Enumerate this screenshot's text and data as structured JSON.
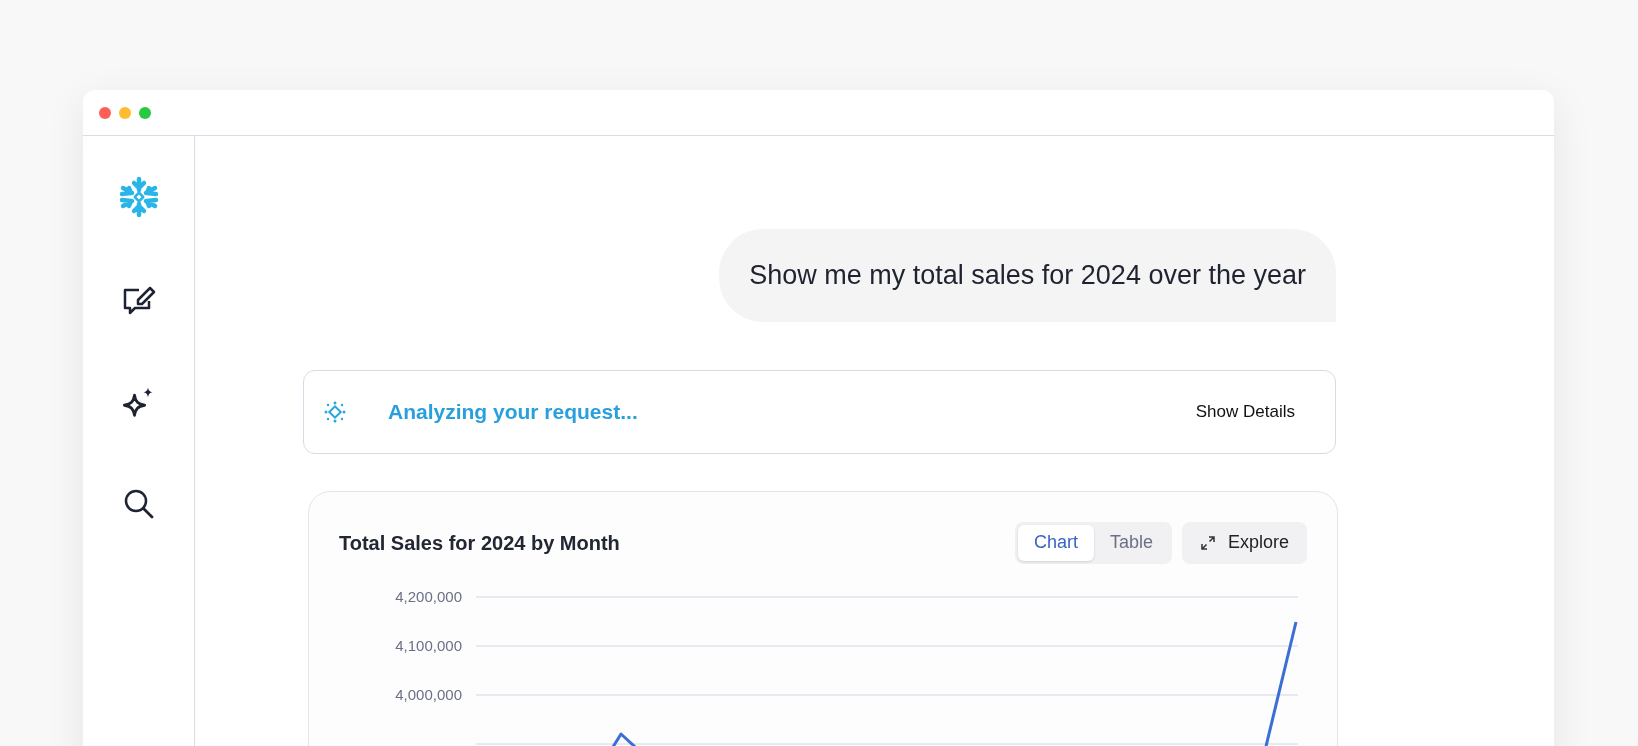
{
  "window": {
    "controls": [
      {
        "color": "#ff5f57"
      },
      {
        "color": "#febc2e"
      },
      {
        "color": "#28c840"
      }
    ]
  },
  "sidebar": {
    "items": [
      {
        "kind": "logo"
      },
      {
        "kind": "new-chat"
      },
      {
        "kind": "sparkles"
      },
      {
        "kind": "search"
      }
    ]
  },
  "message": {
    "text": "Show me my total sales for 2024 over the year"
  },
  "status": {
    "text": "Analyzing your request...",
    "button": "Show Details"
  },
  "result": {
    "title": "Total Sales for 2024 by Month",
    "views": [
      {
        "label": "Chart",
        "selected": true
      },
      {
        "label": "Table",
        "selected": false
      }
    ],
    "explore": "Explore",
    "axis_labels": [
      "4,200,000",
      "4,100,000",
      "4,000,000"
    ]
  }
}
